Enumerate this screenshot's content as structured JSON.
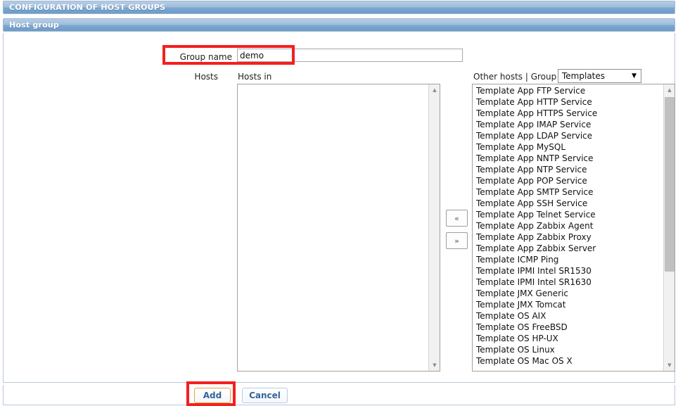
{
  "window": {
    "title": "CONFIGURATION OF HOST GROUPS",
    "section_title": "Host group"
  },
  "form": {
    "group_name_label": "Group name",
    "group_name_value": "demo",
    "group_name_placeholder": "",
    "hosts_label": "Hosts",
    "hosts_in_caption": "Hosts in",
    "other_hosts_caption": "Other hosts | Group",
    "group_select_value": "Templates",
    "group_select_caret": "▼",
    "move_left_label": "«",
    "move_right_label": "»"
  },
  "hosts_in": {
    "items": [],
    "scroll_up_icon": "▲",
    "scroll_down_icon": "▼"
  },
  "other_hosts": {
    "items": [
      "Template App FTP Service",
      "Template App HTTP Service",
      "Template App HTTPS Service",
      "Template App IMAP Service",
      "Template App LDAP Service",
      "Template App MySQL",
      "Template App NNTP Service",
      "Template App NTP Service",
      "Template App POP Service",
      "Template App SMTP Service",
      "Template App SSH Service",
      "Template App Telnet Service",
      "Template App Zabbix Agent",
      "Template App Zabbix Proxy",
      "Template App Zabbix Server",
      "Template ICMP Ping",
      "Template IPMI Intel SR1530",
      "Template IPMI Intel SR1630",
      "Template JMX Generic",
      "Template JMX Tomcat",
      "Template OS AIX",
      "Template OS FreeBSD",
      "Template OS HP-UX",
      "Template OS Linux",
      "Template OS Mac OS X"
    ],
    "scroll_up_icon": "▲",
    "scroll_down_icon": "▼"
  },
  "footer": {
    "add_label": "Add",
    "cancel_label": "Cancel"
  },
  "colors": {
    "titlebar_blue": "#7ba7cf",
    "annotation_red": "#f41f20",
    "add_button_border": "#e8a33d",
    "cancel_button_border": "#b9cbe0",
    "button_text": "#36639c"
  }
}
